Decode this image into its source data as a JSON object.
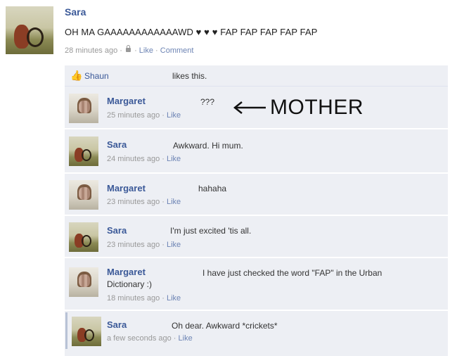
{
  "post": {
    "author": "Sara",
    "text": "OH MA GAAAAAAAAAAAAWD ♥ ♥ ♥ FAP FAP FAP FAP FAP",
    "time": "28 minutes ago",
    "like_label": "Like",
    "comment_label": "Comment"
  },
  "likes": {
    "user": "Shaun",
    "text": "likes this."
  },
  "annotation": "MOTHER",
  "comments": [
    {
      "name": "Margaret",
      "text": "???",
      "time": "25 minutes ago",
      "like": "Like"
    },
    {
      "name": "Sara",
      "text": "Awkward. Hi mum.",
      "time": "24 minutes ago",
      "like": "Like"
    },
    {
      "name": "Margaret",
      "text": "hahaha",
      "time": "23 minutes ago",
      "like": "Like"
    },
    {
      "name": "Sara",
      "text": "I'm just excited 'tis all.",
      "time": "23 minutes ago",
      "like": "Like"
    },
    {
      "name": "Margaret",
      "text": "I have just checked the word \"FAP\" in the Urban",
      "text2": "Dictionary :)",
      "time": "18 minutes ago",
      "like": "Like"
    },
    {
      "name": "Sara",
      "text": "Oh dear. Awkward *crickets*",
      "time": "a few seconds ago",
      "like": "Like"
    }
  ]
}
